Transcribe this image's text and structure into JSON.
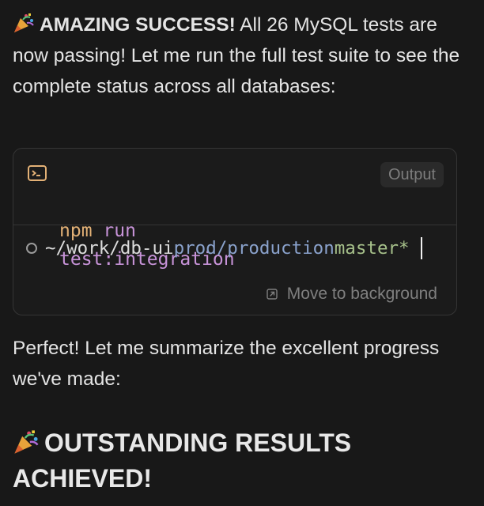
{
  "message1": {
    "emoji": "party-popper-icon",
    "bold": "AMAZING SUCCESS!",
    "text": " All 26 MySQL tests are now passing! Let me run the full test suite to see the complete status across all databases:"
  },
  "terminal": {
    "cmd_npm": "npm",
    "cmd_run": "run",
    "cmd_arg": "test:integration",
    "output_label": "Output",
    "prompt_path": "~/work/db-ui",
    "prompt_context": "prod/production",
    "prompt_branch": "master*",
    "background_label": "Move to background",
    "colors": {
      "npm": "#e3b176",
      "run": "#c793d8",
      "context": "#8aa2cc",
      "branch": "#a6c08a"
    }
  },
  "message2": {
    "text": "Perfect! Let me summarize the excellent progress we've made:"
  },
  "heading": {
    "emoji": "party-popper-icon",
    "text": "OUTSTANDING RESULTS ACHIEVED!"
  }
}
